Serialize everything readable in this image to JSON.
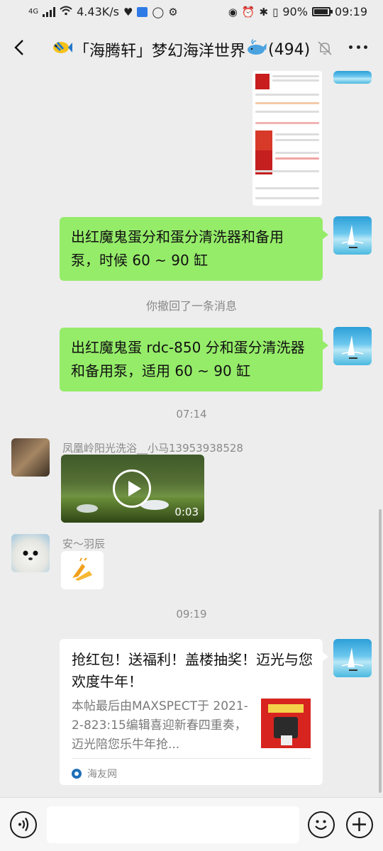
{
  "status_bar": {
    "network": "4G",
    "speed": "4.43K/s",
    "battery": "90%",
    "time": "09:19"
  },
  "header": {
    "title": "「海腾轩」梦幻海洋世界",
    "member_count": "(494)",
    "icons": [
      "back-icon",
      "fish-emoji",
      "whale-emoji",
      "mute-bell-icon",
      "more-icon"
    ]
  },
  "messages": {
    "msg1": "出红魔鬼蛋分和蛋分清洗器和备用泵，时候 60 ~ 90 缸",
    "recall_notice": "你撤回了一条消息",
    "msg2": "出红魔鬼蛋 rdc-850 分和蛋分清洗器和备用泵，适用 60 ~ 90 缸",
    "time1": "07:14",
    "sender1": "凤凰岭阳光洗浴__小马13953938528",
    "video_duration": "0:03",
    "sender2": "安～羽辰",
    "time2": "09:19"
  },
  "card": {
    "title": "抢红包！送福利！盖楼抽奖！迈光与您欢度牛年！",
    "description": "本帖最后由MAXSPECT于 2021-2-823:15编辑喜迎新春四重奏，迈光陪您乐牛年抢...",
    "source": "海友网"
  },
  "colors": {
    "background": "#ededed",
    "sent_bubble": "#95ec69"
  }
}
